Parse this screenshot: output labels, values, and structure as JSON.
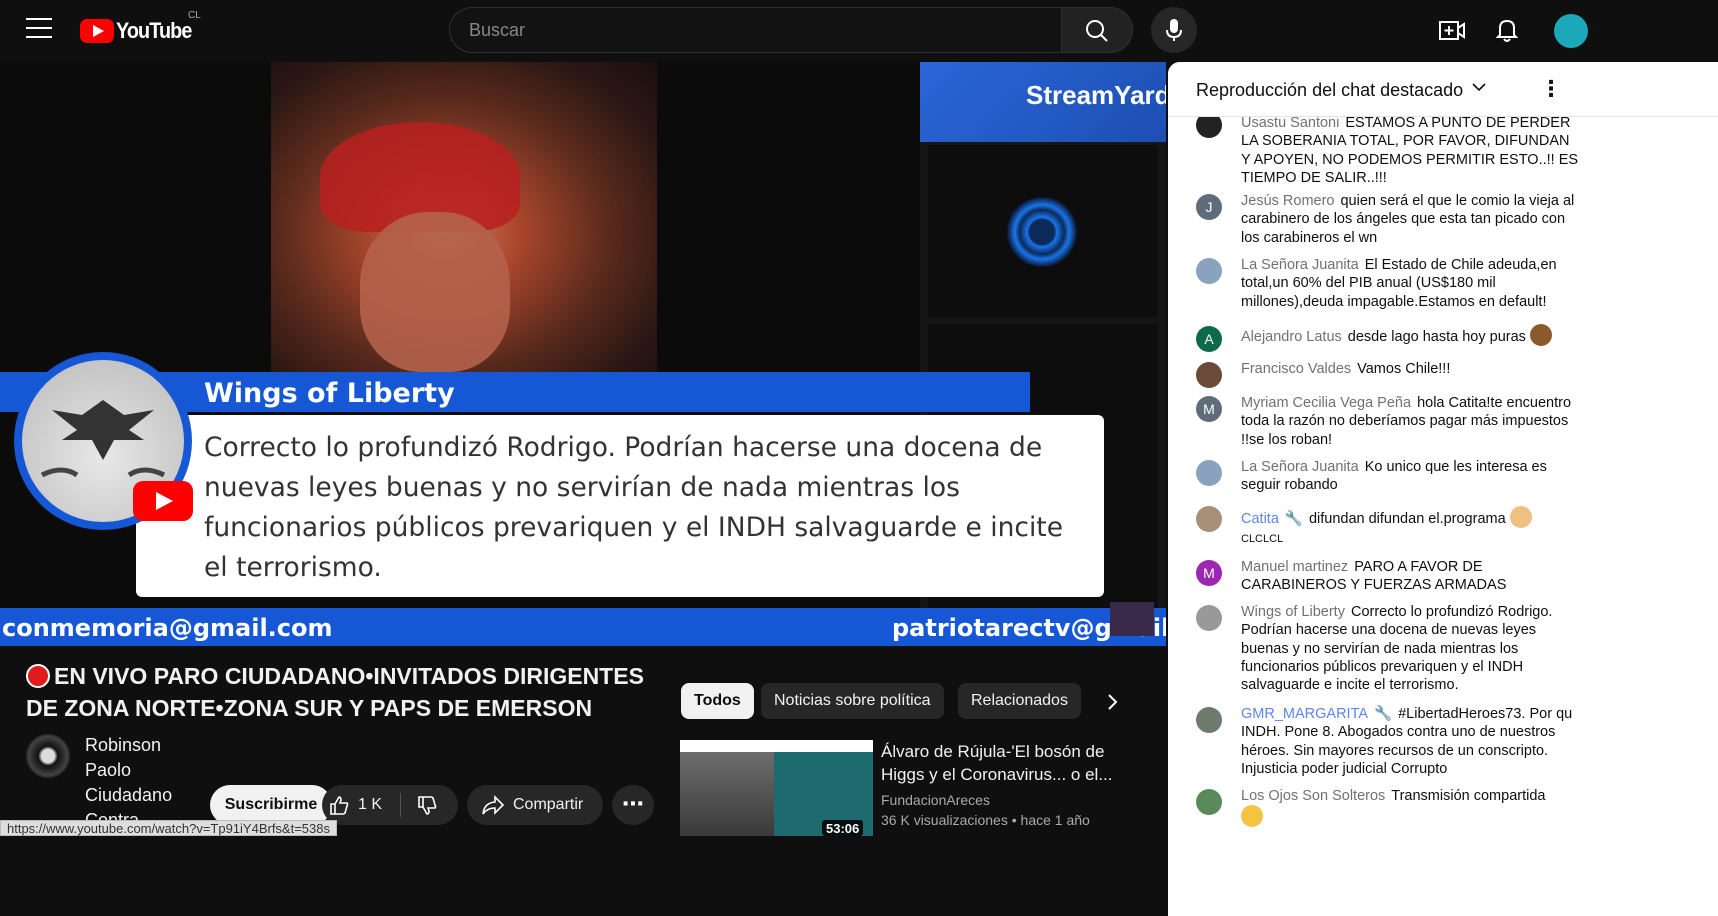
{
  "header": {
    "logo_text": "YouTube",
    "country_code": "CL",
    "search_placeholder": "Buscar"
  },
  "video": {
    "streamyard": "StreamYard",
    "lower_third_name": "Wings of Liberty",
    "caption": "Correcto lo profundizó Rodrigo. Podrían hacerse una docena de nuevas leyes buenas y no servirían de nada mientras los funcionarios públicos prevariquen y el INDH salvaguarde e incite el terrorismo.",
    "email_left": "conmemoria@gmail.com",
    "email_right": "patriotarectv@gmail.co"
  },
  "meta": {
    "title": "EN VIVO PARO CIUDADANO•INVITADOS DIRIGENTES DE ZONA NORTE•ZONA SUR Y PAPS DE EMERSON",
    "channel_name": "Robinson Paolo Ciudadano Contra",
    "subscribe_label": "Suscribirme",
    "like_count": "1 K",
    "share_label": "Compartir",
    "url_tooltip": "https://www.youtube.com/watch?v=Tp91iY4Brfs&t=538s"
  },
  "chips": [
    "Todos",
    "Noticias sobre política",
    "Relacionados"
  ],
  "recommendation": {
    "title": "Álvaro de Rújula-'El bosón de Higgs y el Coronavirus... o el...",
    "channel": "FundacionAreces",
    "views": "36 K visualizaciones",
    "age": "hace 1 año",
    "duration": "53:06"
  },
  "chat": {
    "title": "Reproducción del chat destacado",
    "messages": [
      {
        "author": "Usastu Santoni",
        "text": "ESTAMOS A PUNTO DE PERDER LA SOBERANIA TOTAL, POR FAVOR, DIFUNDAN Y APOYEN, NO PODEMOS PERMITIR ESTO..!! ES TIEMPO DE SALIR..!!!"
      },
      {
        "author": "Jesús Romero",
        "text": "quien será el que le comio la vieja al carabinero de los ángeles que esta tan picado con los carabineros el wn",
        "initial": "J"
      },
      {
        "author": "La Señora Juanita",
        "text": "El Estado de Chile adeuda,en total,un 60% del PIB anual (US$180 mil millones),deuda impagable.Estamos en default!"
      },
      {
        "author": "Alejandro Latus",
        "text": "desde lago hasta hoy puras",
        "initial": "A"
      },
      {
        "author": "Francisco Valdes",
        "text": "Vamos Chile!!!"
      },
      {
        "author": "Myriam Cecilia Vega Peña",
        "text": "hola Catita!te encuentro toda la razón no deberíamos pagar más impuestos !!se los roban!",
        "initial": "M"
      },
      {
        "author": "La Señora Juanita",
        "text": "Ko unico que les interesa es seguir robando"
      },
      {
        "author": "Catita",
        "text": "difundan difundan el.programa",
        "extra": "CLCLCL"
      },
      {
        "author": "Manuel martinez",
        "text": "PARO A FAVOR DE CARABINEROS Y FUERZAS ARMADAS",
        "initial": "M"
      },
      {
        "author": "Wings of Liberty",
        "text": "Correcto lo profundizó Rodrigo. Podrían hacerse una docena de nuevas leyes buenas y no servirían de nada mientras los funcionarios públicos prevariquen y el INDH salvaguarde e incite el terrorismo."
      },
      {
        "author": "GMR_MARGARITA",
        "text": "#LibertadHeroes73. Por qu INDH. Pone 8. Abogados contra uno de nuestros héroes. Sin mayores recursos de un conscripto. Injusticia poder judicial Corrupto"
      },
      {
        "author": "Los Ojos Son Solteros",
        "text": "Transmisión compartida"
      }
    ]
  },
  "colors": {
    "brand_red": "#ff0000",
    "lower_third_blue": "#1657d6",
    "moderator_blue": "#5e84f1"
  }
}
